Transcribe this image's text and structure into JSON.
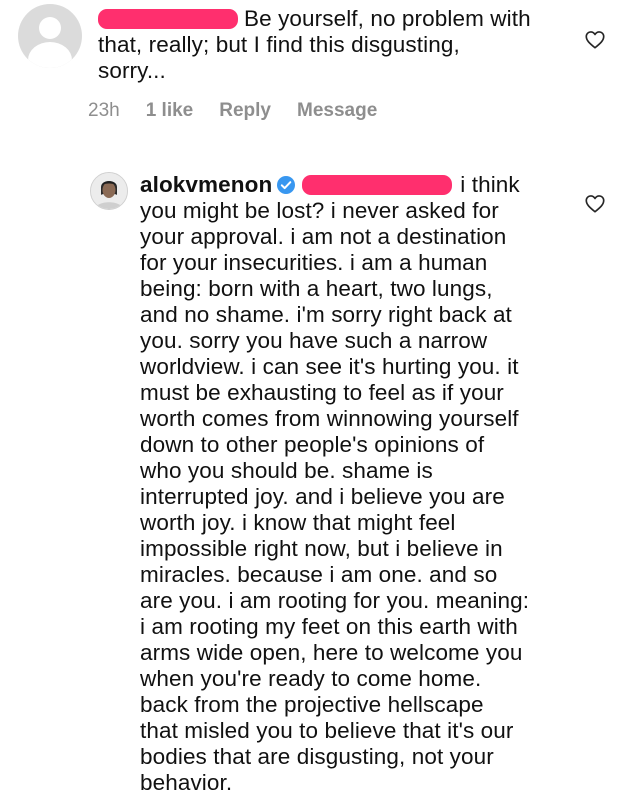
{
  "comments": [
    {
      "text_lines": [
        "Be yourself, no problem with",
        "that, really; but I find this disgusting,",
        "sorry..."
      ],
      "timestamp": "23h",
      "likes": "1 like",
      "reply_label": "Reply",
      "message_label": "Message"
    },
    {
      "username": "alokvmenon",
      "text_lines": [
        "i think",
        "you might be lost? i never asked for",
        "your approval. i am not a destination",
        "for your insecurities. i am a human",
        "being: born with a heart, two lungs,",
        "and no shame. i'm sorry right back at",
        "you. sorry you have such a narrow",
        "worldview. i can see it's hurting you. it",
        "must be exhausting to feel as if your",
        "worth comes from winnowing yourself",
        "down to other people's opinions of",
        "who you should be. shame is",
        "interrupted joy. and i believe you are",
        "worth joy. i know that might feel",
        "impossible right now, but i believe in",
        "miracles. because i am one. and so",
        "are you. i am rooting for you. meaning:",
        "i am rooting my feet on this earth with",
        "arms wide open, here to welcome you",
        "when you're ready to come home.",
        "back from the projective hellscape",
        "that misled you to believe that it's our",
        "bodies that are disgusting, not your",
        "behavior."
      ]
    }
  ],
  "colors": {
    "redaction": "#ff2f6e",
    "verified_badge": "#3897f0",
    "meta_text": "#8e8e8e"
  },
  "icons": {
    "like": "heart-outline-icon",
    "verified": "verified-badge-icon",
    "avatar_placeholder": "default-avatar-icon"
  }
}
